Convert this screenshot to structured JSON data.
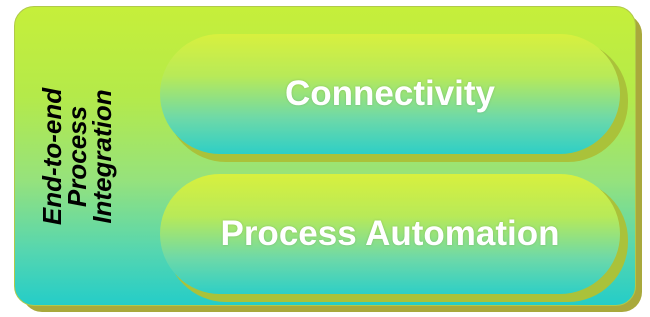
{
  "diagram": {
    "side_label_lines": [
      "End-to-end",
      "Process",
      "Integration"
    ],
    "boxes": [
      {
        "label": "Connectivity"
      },
      {
        "label": "Process Automation"
      }
    ]
  },
  "colors": {
    "panel_top": "#c6ef3a",
    "panel_bottom": "#24cdc8",
    "box_text": "#ffffff",
    "side_label_text": "#000000"
  }
}
